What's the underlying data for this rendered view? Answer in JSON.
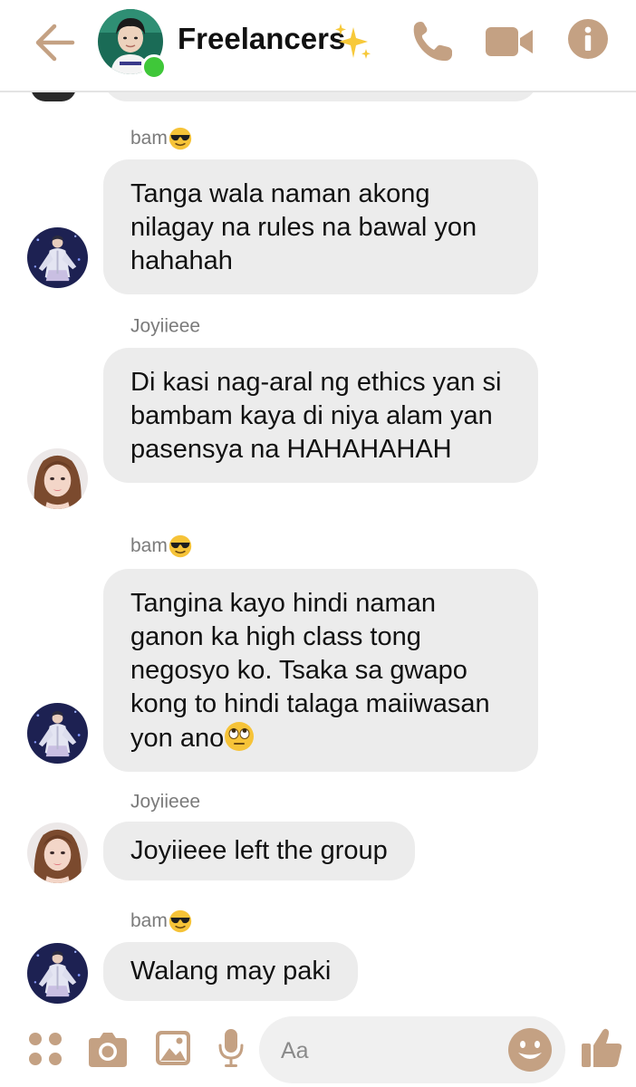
{
  "colors": {
    "accent": "#c4a183",
    "bubble": "#ececec",
    "online": "#3fc739",
    "text": "#111111",
    "sender": "#7b7b7b"
  },
  "header": {
    "title": "Freelancers",
    "title_emoji": "sparkles-emoji",
    "icons": [
      "back-arrow-icon",
      "phone-icon",
      "video-camera-icon",
      "info-icon"
    ]
  },
  "messages": [
    {
      "sender": "bam",
      "sender_emoji": "sunglasses-emoji",
      "text": "Tanga wala naman akong nilagay na rules na bawal yon hahahah"
    },
    {
      "sender": "Joyiieee",
      "text": "Di kasi nag-aral ng ethics yan si bambam kaya di niya alam yan pasensya na HAHAHAHAH"
    },
    {
      "sender": "bam",
      "sender_emoji": "sunglasses-emoji",
      "text": "Tangina kayo hindi naman ganon ka high class tong negosyo ko. Tsaka sa gwapo kong to hindi talaga maiiwasan yon ano",
      "trailing_emoji": "eye-roll-emoji"
    },
    {
      "sender": "Joyiieee",
      "text": "Joyiieee left the group"
    },
    {
      "sender": "bam",
      "sender_emoji": "sunglasses-emoji",
      "text": "Walang may paki"
    }
  ],
  "composer": {
    "placeholder": "Aa",
    "icons": [
      "apps-icon",
      "camera-icon",
      "gallery-icon",
      "microphone-icon",
      "smiley-icon",
      "thumbs-up-icon"
    ]
  }
}
